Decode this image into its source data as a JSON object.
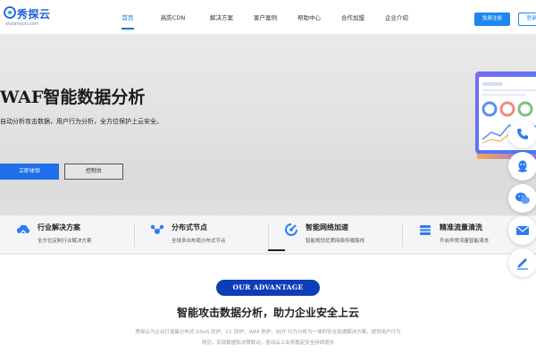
{
  "header": {
    "logo": {
      "name": "秀探云",
      "domain": "xiutanyun.com"
    },
    "nav": [
      {
        "label": "首页",
        "active": true
      },
      {
        "label": "高防CDN",
        "active": false
      },
      {
        "label": "解决方案",
        "active": false
      },
      {
        "label": "客户案例",
        "active": false
      },
      {
        "label": "帮助中心",
        "active": false
      },
      {
        "label": "合作加盟",
        "active": false
      },
      {
        "label": "企业介绍",
        "active": false
      }
    ],
    "register_label": "免费注册",
    "login_label": "登录"
  },
  "hero": {
    "title": "WAF智能数据分析",
    "subtitle": "自动分析攻击数据，用户行为分析，全方位保护上云安全。",
    "primary_button": "立即体验",
    "secondary_button": "控制台"
  },
  "features": [
    {
      "icon": "cloud-icon",
      "title": "行业解决方案",
      "desc": "全方位定制行业解决方案"
    },
    {
      "icon": "nodes-icon",
      "title": "分布式节点",
      "desc": "全球多出布局分布式节点"
    },
    {
      "icon": "accelerate-icon",
      "title": "智能网络加速",
      "desc": "智能规划优质网络传输路线"
    },
    {
      "icon": "filter-icon",
      "title": "精准流量清洗",
      "desc": "开启异常流量智能清洗"
    }
  ],
  "float_toolbar": [
    {
      "icon": "phone-icon"
    },
    {
      "icon": "qq-icon"
    },
    {
      "icon": "wechat-icon"
    },
    {
      "icon": "mail-icon"
    },
    {
      "icon": "edit-icon"
    }
  ],
  "advantage": {
    "badge": "OUR ADVANTAGE",
    "title": "智能攻击数据分析，助力企业安全上云",
    "desc": "秀探云为企业打造集分布式 DDoS 防护、CC 防护、WAF 防护、BOT 行为分析为一体的安全加速解决方案。提供用户行为洞见，实现数据和决策联动，驱动云上业务稳定安全持续增长"
  },
  "colors": {
    "brand": "#1f6fe5",
    "button_blue": "#1e88f0",
    "badge_navy": "#0e3db8",
    "icon_blue": "#2f7cf0"
  }
}
